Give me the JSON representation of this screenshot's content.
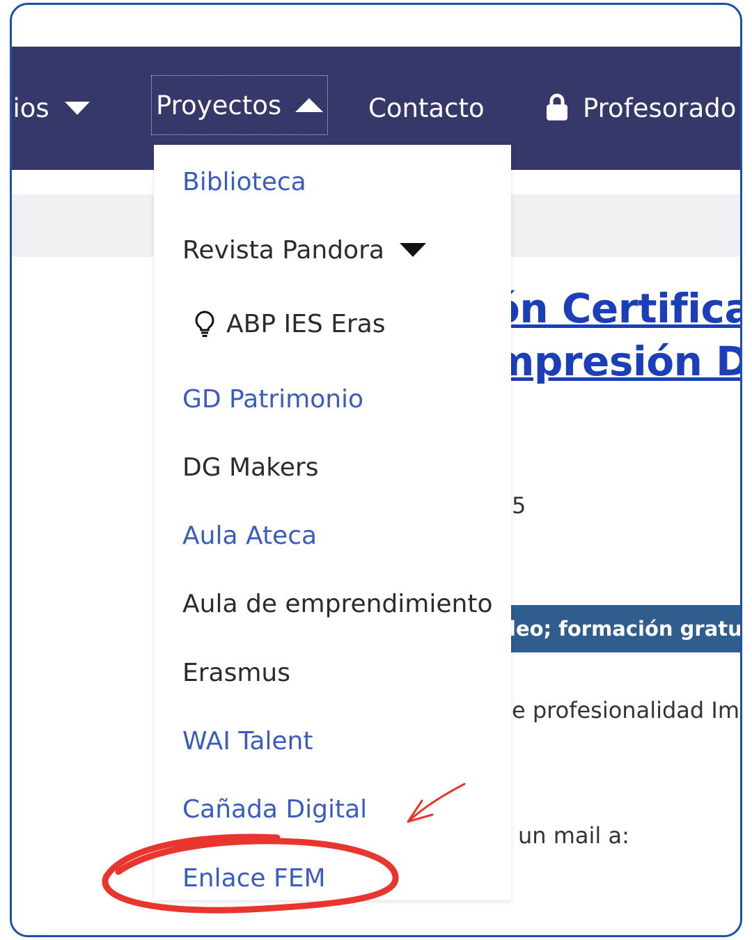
{
  "nav": {
    "estudios_label": "dios",
    "proyectos_label": "Proyectos",
    "contacto_label": "Contacto",
    "profesorado_label": "Profesorado"
  },
  "dropdown": {
    "items": [
      {
        "label": "Biblioteca"
      },
      {
        "label": "Revista Pandora"
      },
      {
        "label": "ABP IES Eras"
      },
      {
        "label": "GD Patrimonio"
      },
      {
        "label": "DG Makers"
      },
      {
        "label": "Aula Ateca"
      },
      {
        "label": "Aula de emprendimiento"
      },
      {
        "label": "Erasmus"
      },
      {
        "label": "WAI Talent"
      },
      {
        "label": "Cañada Digital"
      },
      {
        "label": "Enlace FEM"
      }
    ]
  },
  "background": {
    "title_line1": "ón Certifica",
    "title_line2": "mpresión D",
    "date_fragment": "5",
    "banner_fragment": "leo; formación gratuit",
    "text_fragment_1": "e profesionalidad Im",
    "text_fragment_2": "un mail a:"
  },
  "colors": {
    "navbar": "#36386a",
    "link": "#3a5bbf",
    "title_link": "#1a3fb8",
    "banner": "#2f5e8e",
    "frame_border": "#1f4fa6",
    "annotation": "#e8362f"
  }
}
